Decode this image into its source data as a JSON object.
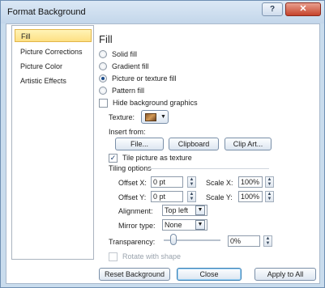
{
  "window": {
    "title": "Format Background",
    "help_icon": "question-mark",
    "close_icon": "x"
  },
  "nav": {
    "items": [
      {
        "label": "Fill",
        "selected": true
      },
      {
        "label": "Picture Corrections",
        "selected": false
      },
      {
        "label": "Picture Color",
        "selected": false
      },
      {
        "label": "Artistic Effects",
        "selected": false
      }
    ]
  },
  "fill": {
    "heading": "Fill",
    "options": [
      {
        "label": "Solid fill",
        "selected": false
      },
      {
        "label": "Gradient fill",
        "selected": false
      },
      {
        "label": "Picture or texture fill",
        "selected": true
      },
      {
        "label": "Pattern fill",
        "selected": false
      }
    ],
    "hide_bg": {
      "label": "Hide background graphics",
      "checked": false
    },
    "texture_label": "Texture:",
    "insert_from_label": "Insert from:",
    "buttons": {
      "file": "File...",
      "clipboard": "Clipboard",
      "clip_art": "Clip Art..."
    },
    "tile": {
      "label": "Tile picture as texture",
      "checked": true
    },
    "tiling_options_label": "Tiling options",
    "offset_x": {
      "label": "Offset X:",
      "value": "0 pt"
    },
    "offset_y": {
      "label": "Offset Y:",
      "value": "0 pt"
    },
    "scale_x": {
      "label": "Scale X:",
      "value": "100%"
    },
    "scale_y": {
      "label": "Scale Y:",
      "value": "100%"
    },
    "alignment": {
      "label": "Alignment:",
      "value": "Top left"
    },
    "mirror": {
      "label": "Mirror type:",
      "value": "None"
    },
    "transparency": {
      "label": "Transparency:",
      "value": "0%",
      "level": 0
    },
    "rotate": {
      "label": "Rotate with shape",
      "checked": false,
      "disabled": true
    }
  },
  "footer": {
    "reset": "Reset Background",
    "close": "Close",
    "apply_all": "Apply to All"
  }
}
